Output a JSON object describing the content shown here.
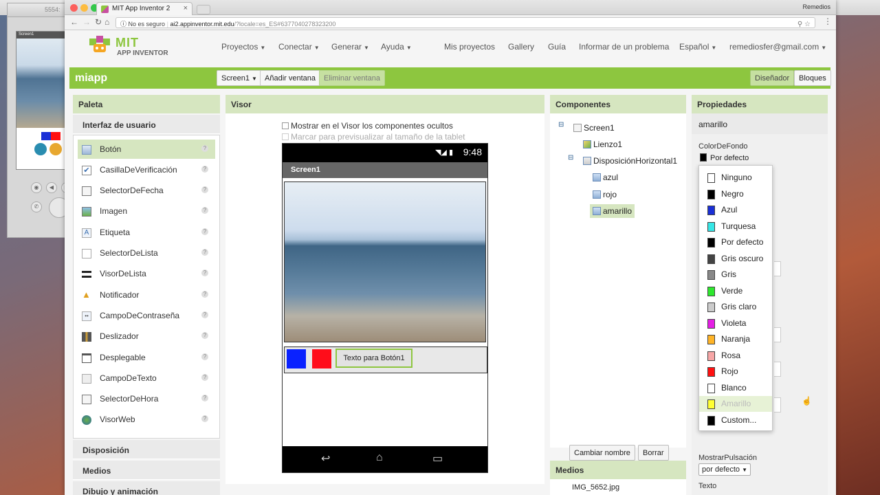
{
  "emulator": {
    "title": "5554:",
    "screen_label": "Screen1"
  },
  "browser": {
    "tab_title": "MIT App Inventor 2",
    "user": "Remedios",
    "security": "No es seguro",
    "url_host": "ai2.appinventor.mit.edu",
    "url_path": "/?locale=es_ES#6377040278323200"
  },
  "logo": {
    "line1": "MIT",
    "line2": "APP INVENTOR"
  },
  "nav": {
    "menus": [
      "Proyectos",
      "Conectar",
      "Generar",
      "Ayuda"
    ],
    "links": [
      "Mis proyectos",
      "Gallery",
      "Guía",
      "Informar de un problema"
    ],
    "language": "Español",
    "account": "remediosfer@gmail.com"
  },
  "toolbar": {
    "project": "miapp",
    "screen": "Screen1",
    "add_screen": "Añadir ventana",
    "remove_screen": "Eliminar ventana",
    "designer": "Diseñador",
    "blocks": "Bloques"
  },
  "palette": {
    "title": "Paleta",
    "section": "Interfaz de usuario",
    "items": [
      "Botón",
      "CasillaDeVerificación",
      "SelectorDeFecha",
      "Imagen",
      "Etiqueta",
      "SelectorDeLista",
      "VisorDeLista",
      "Notificador",
      "CampoDeContraseña",
      "Deslizador",
      "Desplegable",
      "CampoDeTexto",
      "SelectorDeHora",
      "VisorWeb"
    ],
    "other_sections": [
      "Disposición",
      "Medios",
      "Dibujo y animación"
    ]
  },
  "viewer": {
    "title": "Visor",
    "show_hidden": "Mostrar en el Visor los componentes ocultos",
    "tablet_preview": "Marcar para previsualizar al tamaño de la tablet",
    "status_time": "9:48",
    "screen_title": "Screen1",
    "button_text": "Texto para Botón1",
    "squares": [
      "#0a22ff",
      "#ff0d1a"
    ]
  },
  "components": {
    "title": "Componentes",
    "tree": [
      "Screen1",
      "Lienzo1",
      "DisposiciónHorizontal1",
      "azul",
      "rojo",
      "amarillo"
    ],
    "rename": "Cambiar nombre",
    "delete": "Borrar",
    "media_title": "Medios",
    "media_file": "IMG_5652.jpg"
  },
  "properties": {
    "title": "Propiedades",
    "selected": "amarillo",
    "bg_label": "ColorDeFondo",
    "bg_value": "Por defecto",
    "shape_value": "por defecto",
    "feedback_label": "MostrarPulsación",
    "text_label": "Texto"
  },
  "color_menu": [
    {
      "label": "Ninguno",
      "color": "#ffffff"
    },
    {
      "label": "Negro",
      "color": "#000000"
    },
    {
      "label": "Azul",
      "color": "#1a2fd6"
    },
    {
      "label": "Turquesa",
      "color": "#36e6e6"
    },
    {
      "label": "Por defecto",
      "color": "#000000"
    },
    {
      "label": "Gris oscuro",
      "color": "#444444"
    },
    {
      "label": "Gris",
      "color": "#888888"
    },
    {
      "label": "Verde",
      "color": "#2ee82e"
    },
    {
      "label": "Gris claro",
      "color": "#cccccc"
    },
    {
      "label": "Violeta",
      "color": "#e41ee4"
    },
    {
      "label": "Naranja",
      "color": "#ffb427"
    },
    {
      "label": "Rosa",
      "color": "#f7a6a6"
    },
    {
      "label": "Rojo",
      "color": "#ff1010"
    },
    {
      "label": "Blanco",
      "color": "#ffffff"
    },
    {
      "label": "Amarillo",
      "color": "#ffff33"
    },
    {
      "label": "Custom...",
      "color": "#000000"
    }
  ]
}
